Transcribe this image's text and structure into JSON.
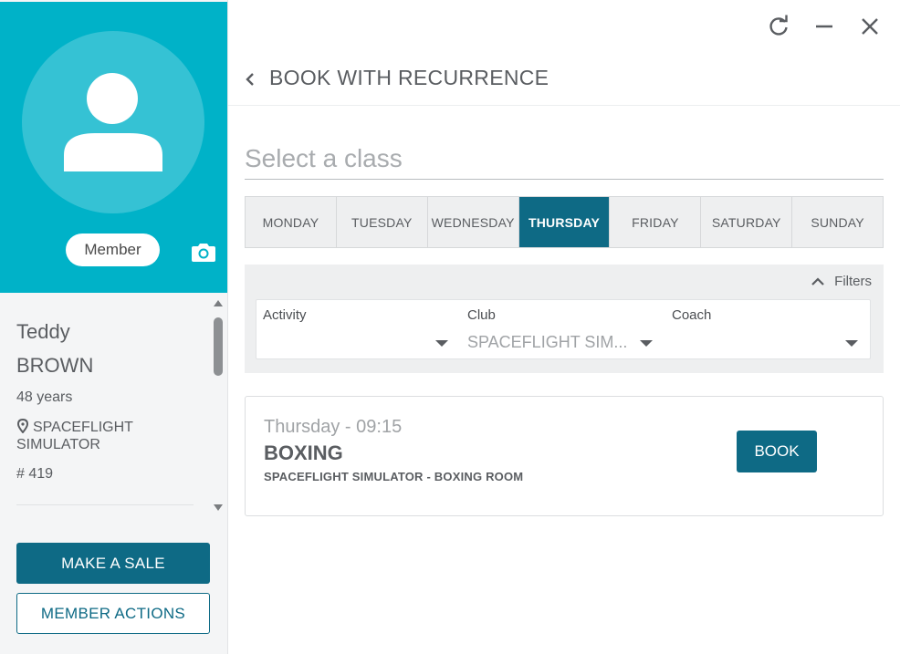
{
  "colors": {
    "brand_cyan": "#00b2c8",
    "primary": "#0e6a85",
    "text": "#5a5d61",
    "muted": "#a0a3a6"
  },
  "window_controls": {
    "icons": [
      "refresh-icon",
      "minimize-icon",
      "close-icon"
    ]
  },
  "member": {
    "badge_label": "Member",
    "first_name": "Teddy",
    "last_name": "BROWN",
    "age": "48 years",
    "club": "SPACEFLIGHT SIMULATOR",
    "number": "# 419",
    "avatar_icon": "user-icon",
    "camera_icon": "camera-icon",
    "location_icon": "location-pin-icon"
  },
  "actions": {
    "make_sale": "MAKE A SALE",
    "member_actions": "MEMBER ACTIONS"
  },
  "header": {
    "back_icon": "chevron-left-icon",
    "title": "BOOK WITH RECURRENCE"
  },
  "select_class": {
    "placeholder": "Select a class"
  },
  "days": [
    {
      "label": "MONDAY",
      "active": false
    },
    {
      "label": "TUESDAY",
      "active": false
    },
    {
      "label": "WEDNESDAY",
      "active": false
    },
    {
      "label": "THURSDAY",
      "active": true
    },
    {
      "label": "FRIDAY",
      "active": false
    },
    {
      "label": "SATURDAY",
      "active": false
    },
    {
      "label": "SUNDAY",
      "active": false
    }
  ],
  "filters": {
    "toggle_label": "Filters",
    "toggle_icon": "chevron-up-icon",
    "activity": {
      "label": "Activity",
      "value": ""
    },
    "club": {
      "label": "Club",
      "value": "SPACEFLIGHT SIM..."
    },
    "coach": {
      "label": "Coach",
      "value": ""
    }
  },
  "class_card": {
    "time": "Thursday - 09:15",
    "name": "BOXING",
    "location": "SPACEFLIGHT SIMULATOR - BOXING ROOM",
    "book_label": "BOOK"
  }
}
